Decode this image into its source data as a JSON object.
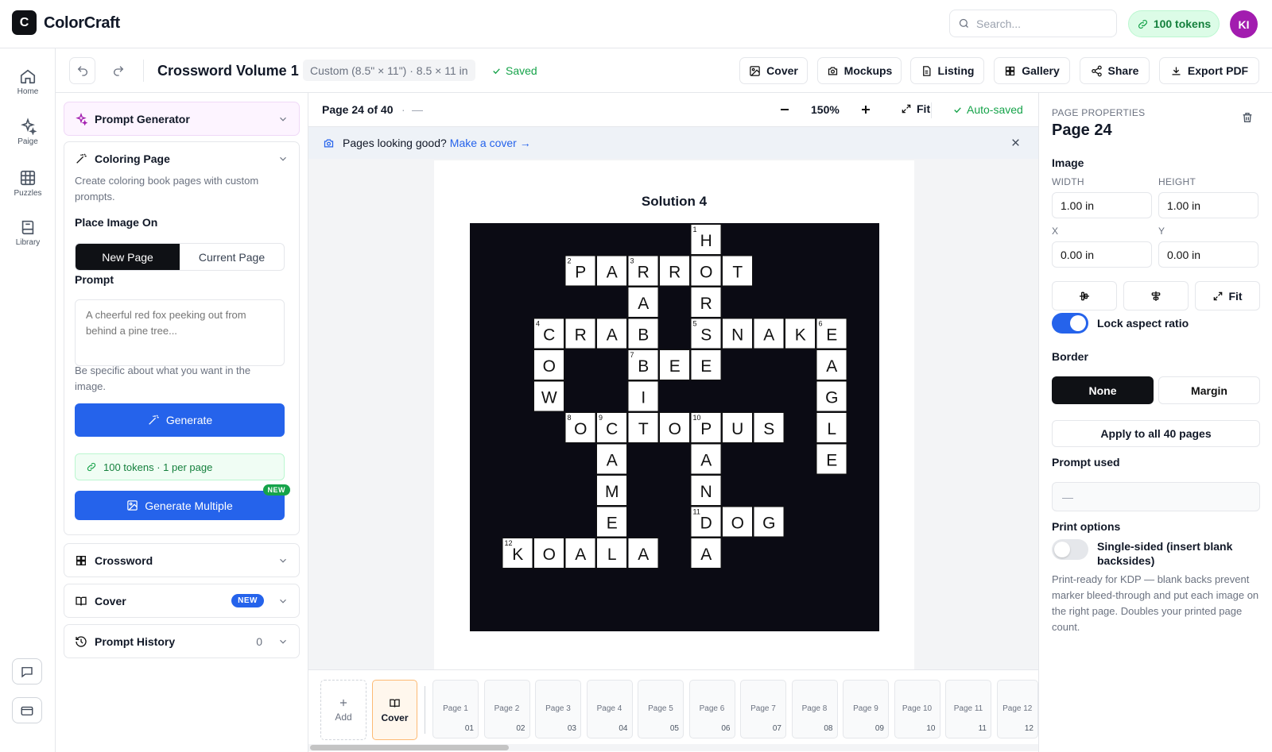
{
  "app": {
    "logo_letter": "C",
    "name": "ColorCraft"
  },
  "topbar": {
    "search_placeholder": "Search...",
    "tokens_label": "100 tokens",
    "avatar_initials": "KI"
  },
  "rail": [
    {
      "label": "Home",
      "icon": "home-icon"
    },
    {
      "label": "Paige",
      "icon": "sparkles-icon"
    },
    {
      "label": "Puzzles",
      "icon": "grid-icon"
    },
    {
      "label": "Library",
      "icon": "book-icon"
    }
  ],
  "toolbar": {
    "title": "Crossword Volume 1",
    "size": "Custom (8.5\" × 11\") · 8.5 × 11 in",
    "saved": "Saved",
    "buttons": {
      "cover": "Cover",
      "mockups": "Mockups",
      "listing": "Listing",
      "gallery": "Gallery",
      "share": "Share",
      "export": "Export PDF"
    }
  },
  "left": {
    "prompt_generator": "Prompt Generator",
    "coloring": {
      "title": "Coloring Page",
      "desc": "Create coloring book pages with custom prompts.",
      "place_label": "Place Image On",
      "new_page": "New Page",
      "current_page": "Current Page",
      "prompt_label": "Prompt",
      "prompt_placeholder": "A cheerful red fox peeking out from behind a pine tree...",
      "hint": "Be specific about what you want in the image.",
      "generate": "Generate",
      "tokens_info": "100 tokens · 1 per page",
      "generate_multiple": "Generate Multiple",
      "new_tag": "NEW"
    },
    "crossword": "Crossword",
    "cover": "Cover",
    "cover_badge": "NEW",
    "history": "Prompt History",
    "history_count": "0"
  },
  "canvas": {
    "page_indicator": "Page 24 of 40",
    "dot": "·",
    "dash": "—",
    "zoom": "150%",
    "fit": "Fit",
    "autosaved": "Auto-saved",
    "banner_text": "Pages looking good?",
    "banner_link": "Make a cover →",
    "page_title": "Solution 4"
  },
  "crossword": {
    "cells": [
      {
        "r": 0,
        "c": 7,
        "ch": "H",
        "n": "1"
      },
      {
        "r": 1,
        "c": 3,
        "ch": "P",
        "n": "2"
      },
      {
        "r": 1,
        "c": 4,
        "ch": "A"
      },
      {
        "r": 1,
        "c": 5,
        "ch": "R",
        "n": "3"
      },
      {
        "r": 1,
        "c": 6,
        "ch": "R"
      },
      {
        "r": 1,
        "c": 7,
        "ch": "O"
      },
      {
        "r": 1,
        "c": 8,
        "ch": "T"
      },
      {
        "r": 2,
        "c": 5,
        "ch": "A"
      },
      {
        "r": 2,
        "c": 7,
        "ch": "R"
      },
      {
        "r": 3,
        "c": 2,
        "ch": "C",
        "n": "4"
      },
      {
        "r": 3,
        "c": 3,
        "ch": "R"
      },
      {
        "r": 3,
        "c": 4,
        "ch": "A"
      },
      {
        "r": 3,
        "c": 5,
        "ch": "B"
      },
      {
        "r": 3,
        "c": 7,
        "ch": "S",
        "n": "5"
      },
      {
        "r": 3,
        "c": 8,
        "ch": "N"
      },
      {
        "r": 3,
        "c": 9,
        "ch": "A"
      },
      {
        "r": 3,
        "c": 10,
        "ch": "K"
      },
      {
        "r": 3,
        "c": 11,
        "ch": "E",
        "n": "6"
      },
      {
        "r": 4,
        "c": 2,
        "ch": "O"
      },
      {
        "r": 4,
        "c": 5,
        "ch": "B",
        "n": "7"
      },
      {
        "r": 4,
        "c": 6,
        "ch": "E"
      },
      {
        "r": 4,
        "c": 7,
        "ch": "E"
      },
      {
        "r": 4,
        "c": 11,
        "ch": "A"
      },
      {
        "r": 5,
        "c": 2,
        "ch": "W"
      },
      {
        "r": 5,
        "c": 5,
        "ch": "I"
      },
      {
        "r": 5,
        "c": 11,
        "ch": "G"
      },
      {
        "r": 6,
        "c": 3,
        "ch": "O",
        "n": "8"
      },
      {
        "r": 6,
        "c": 4,
        "ch": "C",
        "n": "9"
      },
      {
        "r": 6,
        "c": 5,
        "ch": "T"
      },
      {
        "r": 6,
        "c": 6,
        "ch": "O"
      },
      {
        "r": 6,
        "c": 7,
        "ch": "P",
        "n": "10"
      },
      {
        "r": 6,
        "c": 8,
        "ch": "U"
      },
      {
        "r": 6,
        "c": 9,
        "ch": "S"
      },
      {
        "r": 6,
        "c": 11,
        "ch": "L"
      },
      {
        "r": 7,
        "c": 4,
        "ch": "A"
      },
      {
        "r": 7,
        "c": 7,
        "ch": "A"
      },
      {
        "r": 7,
        "c": 11,
        "ch": "E"
      },
      {
        "r": 8,
        "c": 4,
        "ch": "M"
      },
      {
        "r": 8,
        "c": 7,
        "ch": "N"
      },
      {
        "r": 9,
        "c": 4,
        "ch": "E"
      },
      {
        "r": 9,
        "c": 7,
        "ch": "D",
        "n": "11"
      },
      {
        "r": 9,
        "c": 8,
        "ch": "O"
      },
      {
        "r": 9,
        "c": 9,
        "ch": "G"
      },
      {
        "r": 10,
        "c": 1,
        "ch": "K",
        "n": "12"
      },
      {
        "r": 10,
        "c": 2,
        "ch": "O"
      },
      {
        "r": 10,
        "c": 3,
        "ch": "A"
      },
      {
        "r": 10,
        "c": 4,
        "ch": "L"
      },
      {
        "r": 10,
        "c": 5,
        "ch": "A"
      },
      {
        "r": 10,
        "c": 7,
        "ch": "A"
      }
    ]
  },
  "strip": {
    "add_label": "Add",
    "cover_label": "Cover",
    "pages": [
      {
        "label": "Page 1",
        "num": "01"
      },
      {
        "label": "Page 2",
        "num": "02"
      },
      {
        "label": "Page 3",
        "num": "03"
      },
      {
        "label": "Page 4",
        "num": "04"
      },
      {
        "label": "Page 5",
        "num": "05"
      },
      {
        "label": "Page 6",
        "num": "06"
      },
      {
        "label": "Page 7",
        "num": "07"
      },
      {
        "label": "Page 8",
        "num": "08"
      },
      {
        "label": "Page 9",
        "num": "09"
      },
      {
        "label": "Page 10",
        "num": "10"
      },
      {
        "label": "Page 11",
        "num": "11"
      },
      {
        "label": "Page 12",
        "num": "12"
      }
    ]
  },
  "right": {
    "section": "PAGE PROPERTIES",
    "page_title": "Page 24",
    "image_label": "Image",
    "width_label": "WIDTH",
    "width": "1.00 in",
    "height_label": "HEIGHT",
    "height": "1.00 in",
    "x_label": "X",
    "x": "0.00 in",
    "y_label": "Y",
    "y": "0.00 in",
    "fit": "Fit",
    "lock_label": "Lock aspect ratio",
    "lock_on": true,
    "border_label": "Border",
    "border_none": "None",
    "border_margin": "Margin",
    "apply_all": "Apply to all 40 pages",
    "prompt_used_label": "Prompt used",
    "prompt_used_value": "—",
    "print_label": "Print options",
    "single_sided": "Single-sided (insert blank backsides)",
    "single_sided_on": false,
    "print_desc": "Print-ready for KDP — blank backs prevent marker bleed-through and put each image on the right page. Doubles your printed page count."
  },
  "colors": {
    "accent": "#2563eb",
    "dark": "#0f1115",
    "success": "#16a34a",
    "avatar": "#a21caf"
  }
}
